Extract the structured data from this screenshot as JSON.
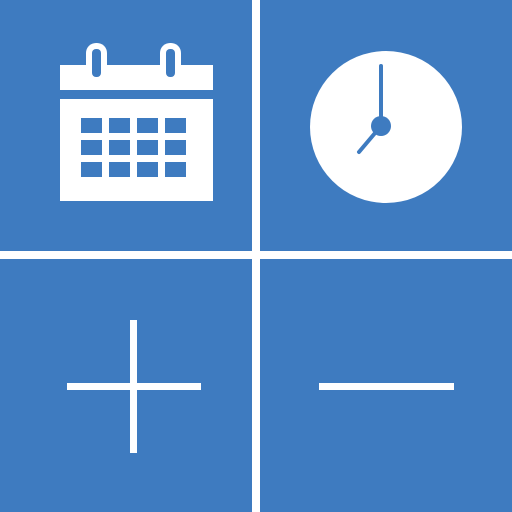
{
  "icon": {
    "tiles": [
      {
        "name": "calendar",
        "icon": "calendar-icon"
      },
      {
        "name": "clock",
        "icon": "clock-icon"
      },
      {
        "name": "add",
        "icon": "plus-icon"
      },
      {
        "name": "subtract",
        "icon": "minus-icon"
      }
    ]
  },
  "colors": {
    "tile": "#3e7bc0",
    "glyph": "#ffffff",
    "divider": "#ffffff"
  }
}
